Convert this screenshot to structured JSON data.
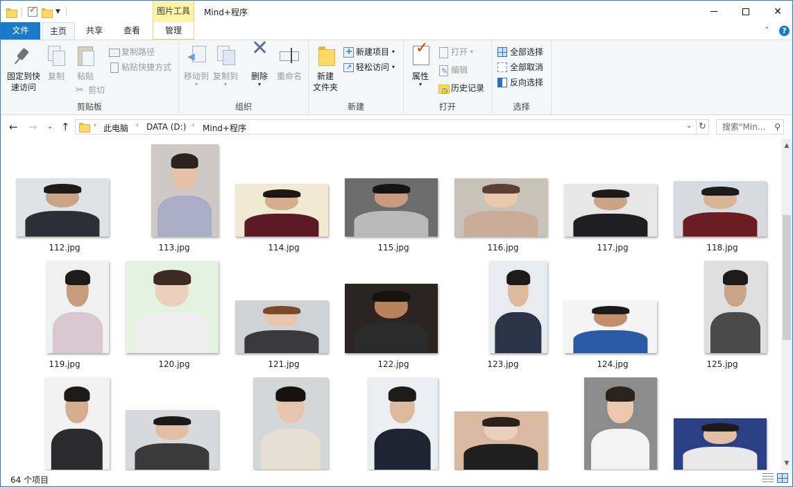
{
  "titlebar": {
    "context_tab_group": "图片工具",
    "title": "Mind+程序",
    "minimize_icon": "minimize-icon",
    "maximize_icon": "maximize-icon",
    "close_icon": "close-icon"
  },
  "tabs": {
    "file": "文件",
    "home": "主页",
    "share": "共享",
    "view": "查看",
    "manage": "管理"
  },
  "ribbon": {
    "clipboard": {
      "label": "剪贴板",
      "pin_line1": "固定到快",
      "pin_line2": "速访问",
      "copy": "复制",
      "paste": "粘贴",
      "copy_path": "复制路径",
      "paste_shortcut": "粘贴快捷方式",
      "cut": "剪切"
    },
    "organize": {
      "label": "组织",
      "move_to": "移动到",
      "copy_to": "复制到",
      "delete": "删除",
      "rename": "重命名"
    },
    "new": {
      "label": "新建",
      "new_folder_line1": "新建",
      "new_folder_line2": "文件夹",
      "new_item": "新建项目",
      "easy_access": "轻松访问"
    },
    "open": {
      "label": "打开",
      "properties": "属性",
      "open": "打开",
      "edit": "编辑",
      "history": "历史记录"
    },
    "select": {
      "label": "选择",
      "select_all": "全部选择",
      "select_none": "全部取消",
      "invert": "反向选择"
    }
  },
  "address": {
    "crumbs": [
      "此电脑",
      "DATA (D:)",
      "Mind+程序"
    ],
    "search_placeholder": "搜索\"Min...",
    "refresh_icon": "refresh-icon"
  },
  "files": [
    {
      "name": "112.jpg",
      "bg": "#dfe3e6",
      "skin": "#caa487",
      "hair": "#1d1b1a",
      "cloth": "#2b2f38"
    },
    {
      "name": "113.jpg",
      "bg": "#cfc9c6",
      "skin": "#e7c2a9",
      "hair": "#2b221c",
      "cloth": "#a9adc6"
    },
    {
      "name": "114.jpg",
      "bg": "#f1ead2",
      "skin": "#d6ad8e",
      "hair": "#1b1715",
      "cloth": "#5b1a24"
    },
    {
      "name": "115.jpg",
      "bg": "#6c6c6c",
      "skin": "#c79c7e",
      "hair": "#161412",
      "cloth": "#b9b9b9"
    },
    {
      "name": "116.jpg",
      "bg": "#c9c2b8",
      "skin": "#e9c8ad",
      "hair": "#5c4033",
      "cloth": "#c9ad9a"
    },
    {
      "name": "117.jpg",
      "bg": "#e7e7e7",
      "skin": "#caa487",
      "hair": "#1d1b1a",
      "cloth": "#1f1f22"
    },
    {
      "name": "118.jpg",
      "bg": "#d7dbe0",
      "skin": "#d9b597",
      "hair": "#1d1b1a",
      "cloth": "#6b1d24"
    },
    {
      "name": "119.jpg",
      "bg": "#f0f0f0",
      "skin": "#c79c7e",
      "hair": "#1d1b1a",
      "cloth": "#d8c8cf"
    },
    {
      "name": "120.jpg",
      "bg": "#e3f3df",
      "skin": "#ecd0bd",
      "hair": "#3d2b22",
      "cloth": "#eeeeee"
    },
    {
      "name": "121.jpg",
      "bg": "#cfd3d6",
      "skin": "#e7c5ad",
      "hair": "#7a4b2a",
      "cloth": "#3a3a3e"
    },
    {
      "name": "122.jpg",
      "bg": "#2b2420",
      "skin": "#b8835c",
      "hair": "#151210",
      "cloth": "#2a2a2a"
    },
    {
      "name": "123.jpg",
      "bg": "#e9ecef",
      "skin": "#dcb89c",
      "hair": "#1d1b1a",
      "cloth": "#2b3346"
    },
    {
      "name": "124.jpg",
      "bg": "#f4f4f4",
      "skin": "#c28f6a",
      "hair": "#1d1b1a",
      "cloth": "#2a5aa6"
    },
    {
      "name": "125.jpg",
      "bg": "#dedede",
      "skin": "#caa487",
      "hair": "#1d1b1a",
      "cloth": "#4a4a4a"
    },
    {
      "name": "",
      "bg": "#f2f2f2",
      "skin": "#d6ad8e",
      "hair": "#1d1b1a",
      "cloth": "#2b2b2e"
    },
    {
      "name": "",
      "bg": "#d7d9dc",
      "skin": "#e2bfa4",
      "hair": "#1d1b1a",
      "cloth": "#3a3a3a"
    },
    {
      "name": "",
      "bg": "#d4d6d8",
      "skin": "#e7c5ad",
      "hair": "#151210",
      "cloth": "#e6e0d2"
    },
    {
      "name": "",
      "bg": "#eceff2",
      "skin": "#dcb89c",
      "hair": "#1d1b1a",
      "cloth": "#1f2433"
    },
    {
      "name": "",
      "bg": "#d9b9a0",
      "skin": "#ecd0bd",
      "hair": "#2b221c",
      "cloth": "#1f1f1f"
    },
    {
      "name": "",
      "bg": "#8c8c8c",
      "skin": "#e9c8ad",
      "hair": "#2b221c",
      "cloth": "#f3f3f3"
    },
    {
      "name": "",
      "bg": "#2b3f86",
      "skin": "#e2bfa4",
      "hair": "#1d1b1a",
      "cloth": "#e9e9e9"
    }
  ],
  "status": {
    "item_count": "64 个项目"
  }
}
